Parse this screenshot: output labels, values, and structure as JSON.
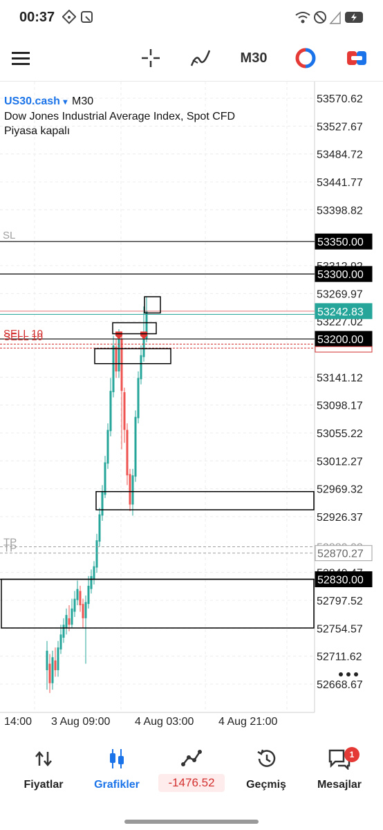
{
  "status_bar": {
    "time": "00:37"
  },
  "toolbar": {
    "period": "M30"
  },
  "chart_header": {
    "symbol": "US30.cash",
    "symbol_caret": "▾",
    "period": "M30",
    "description": "Dow Jones Industrial Average Index, Spot CFD",
    "status": "Piyasa kapalı"
  },
  "chart_data": {
    "type": "candlestick",
    "price_axis": [
      "53570.62",
      "53527.67",
      "53484.72",
      "53441.77",
      "53398.82",
      "53312.92",
      "53269.97",
      "53227.02",
      "53141.12",
      "53098.17",
      "53055.22",
      "53012.27",
      "52969.32",
      "52926.37",
      "52840.47",
      "52797.52",
      "52754.57",
      "52711.62",
      "52668.67"
    ],
    "time_axis": [
      "14:00",
      "3 Aug 09:00",
      "4 Aug 03:00",
      "4 Aug 21:00"
    ],
    "levels": {
      "sl": {
        "label": "SL",
        "price": "53350.00"
      },
      "resistance": {
        "price": "53300.00"
      },
      "bid": {
        "price": "53242.83"
      },
      "entry": {
        "price": "53200.00"
      },
      "sell_labels": [
        "SELL 10",
        "SELL 10"
      ],
      "tp": {
        "labels": [
          "TP",
          "TP"
        ],
        "price": "52870.27",
        "hidden_price": "52880.02"
      },
      "support": {
        "price": "52830.00"
      }
    },
    "colors": {
      "bull": "#26a69a",
      "bear": "#ef5350",
      "bid_tag": "#26a69a",
      "sell": "#d32f2f",
      "line": "#000000",
      "tp_sl": "#9e9e9e"
    }
  },
  "bottom_nav": {
    "items": [
      {
        "label": "Fiyatlar"
      },
      {
        "label": "Grafikler"
      },
      {
        "label": "-1476.52"
      },
      {
        "label": "Geçmiş"
      },
      {
        "label": "Mesajlar",
        "badge": "1"
      }
    ]
  }
}
